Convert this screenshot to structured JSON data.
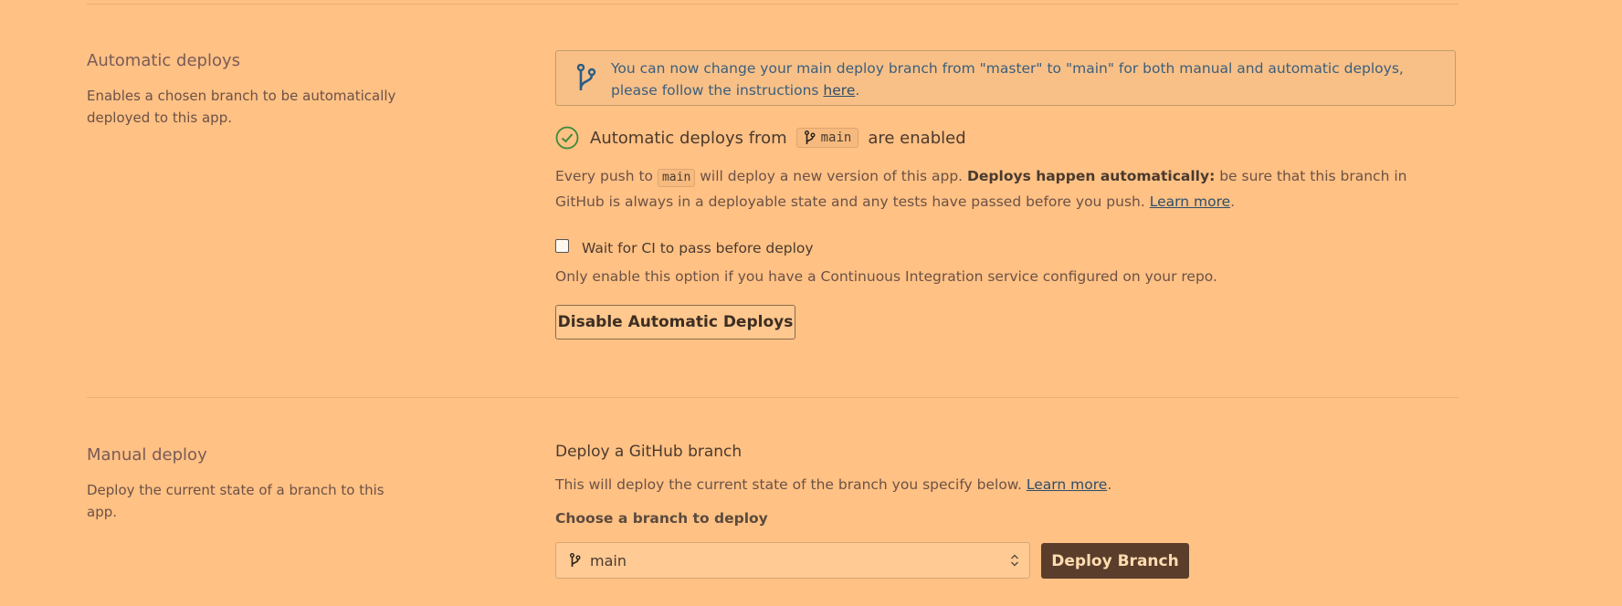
{
  "auto": {
    "title": "Automatic deploys",
    "description": "Enables a chosen branch to be automatically deployed to this app.",
    "banner": {
      "text": "You can now change your main deploy branch from \"master\" to \"main\" for both manual and automatic deploys, please follow the instructions ",
      "link": "here",
      "after": "."
    },
    "status": {
      "prefix": "Automatic deploys from",
      "branch": "main",
      "suffix": "are enabled"
    },
    "paragraph": {
      "p1": "Every push to",
      "branch": "main",
      "p2": " will deploy a new version of this app. ",
      "bold": "Deploys happen automatically:",
      "p3": " be sure that this branch in GitHub is always in a deployable state and any tests have passed before you push. ",
      "link": "Learn more",
      "after": "."
    },
    "ci_checkbox": {
      "label": "Wait for CI to pass before deploy",
      "checked": false
    },
    "ci_hint": "Only enable this option if you have a Continuous Integration service configured on your repo.",
    "disable_button": "Disable Automatic Deploys"
  },
  "manual": {
    "title": "Manual deploy",
    "description": "Deploy the current state of a branch to this app.",
    "subtitle": "Deploy a GitHub branch",
    "sub_desc": "This will deploy the current state of the branch you specify below. ",
    "sub_link": "Learn more",
    "sub_after": ".",
    "choose_label": "Choose a branch to deploy",
    "selected_branch": "main",
    "deploy_button": "Deploy Branch"
  },
  "colors": {
    "background": "#ffc184",
    "link": "#2e4e6a",
    "success": "#3d8a3a",
    "button_dark": "#5a3d2b"
  }
}
